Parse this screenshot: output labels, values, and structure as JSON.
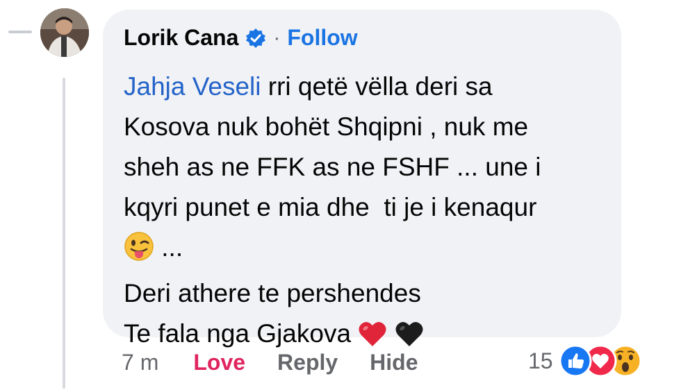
{
  "comment": {
    "author": "Lorik Cana",
    "separator": "·",
    "follow_label": "Follow",
    "mention": "Jahja Veseli",
    "lines": [
      " rri qetë vëlla deri sa",
      "Kosova nuk bohët Shqipni , nuk me",
      "sheh as ne FFK as ne FSHF ... une i",
      "kqyri punet e mia dhe  ti je i kenaqur",
      "...",
      "Deri athere te pershendes",
      "Te fala nga Gjakova "
    ],
    "emoji": {
      "winking_tongue": "winking-tongue-emoji",
      "heart_red": "red-heart-emoji",
      "heart_black": "black-heart-emoji"
    }
  },
  "actions": {
    "time": "7 m",
    "love_label": "Love",
    "reply_label": "Reply",
    "hide_label": "Hide"
  },
  "reactions": {
    "count": "15",
    "icons": [
      "like-icon",
      "love-icon",
      "wow-icon"
    ]
  },
  "colors": {
    "bubble": "#f0f2f5",
    "link_blue": "#1b74e4",
    "love_red": "#e0245e",
    "muted": "#65676b"
  }
}
